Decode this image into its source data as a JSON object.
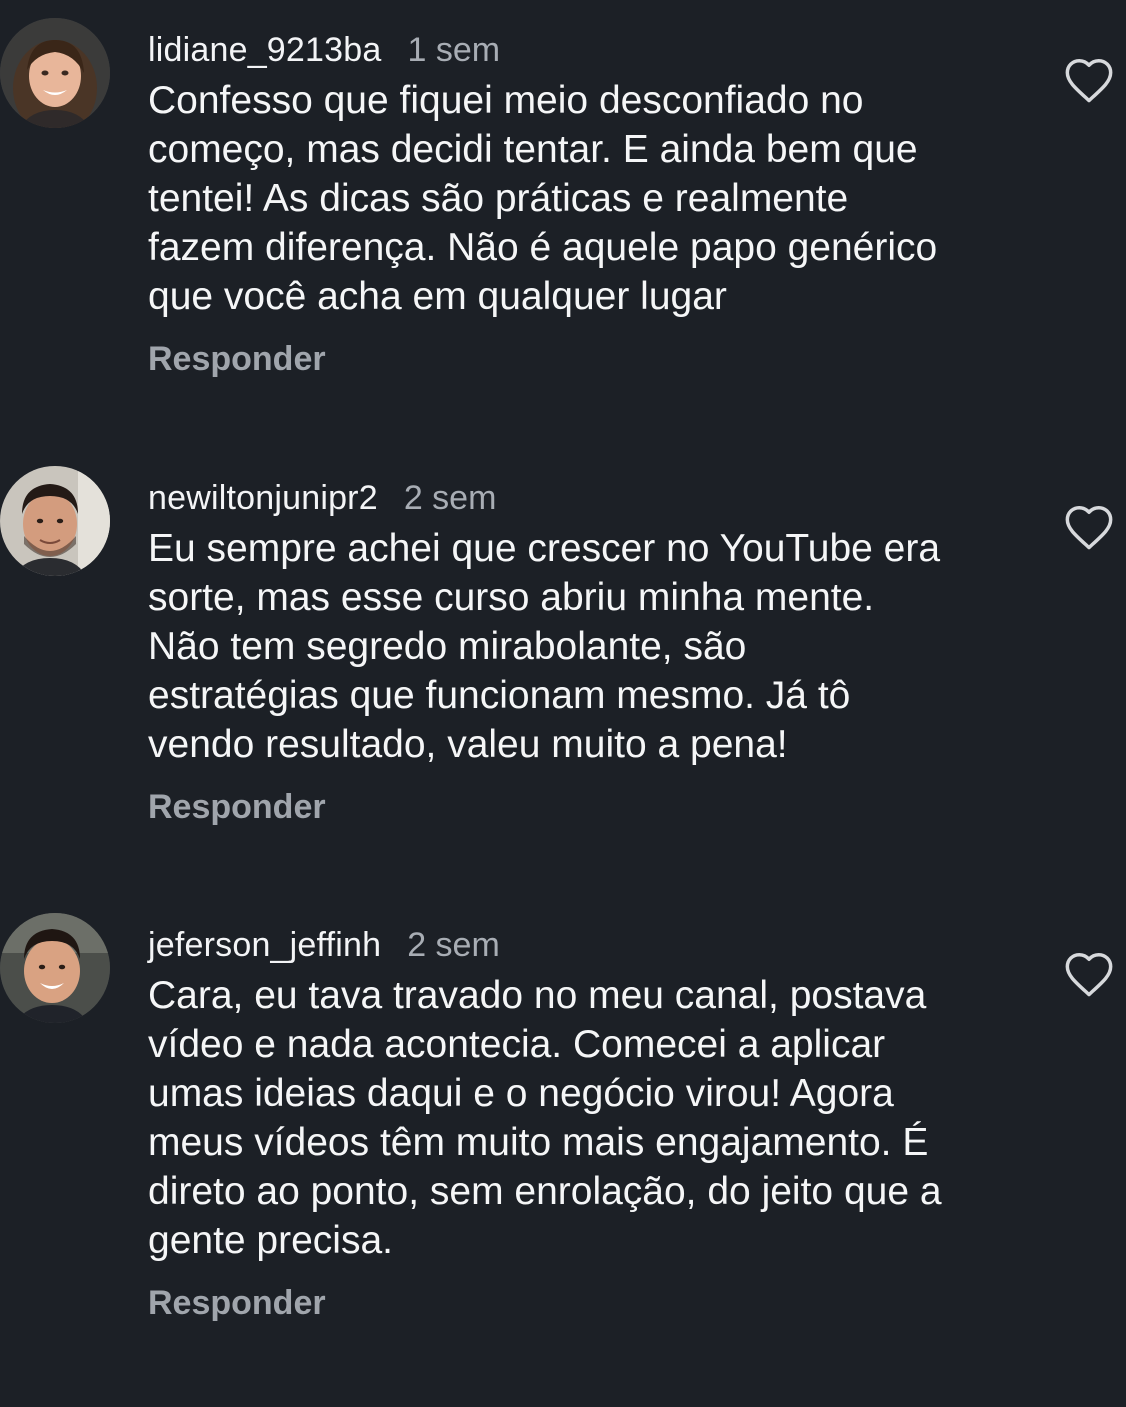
{
  "comments": [
    {
      "username": "lidiane_9213ba",
      "time": "1 sem",
      "text": "Confesso que fiquei meio desconfiado no\ncomeço, mas decidi tentar. E ainda bem que\ntentei! As dicas são práticas e realmente\nfazem diferença. Não é aquele papo genérico\nque você acha em qualquer lugar",
      "reply_label": "Responder",
      "like_icon": "heart-outline-icon"
    },
    {
      "username": "newiltonjunipr2",
      "time": "2 sem",
      "text": "Eu sempre achei que crescer no YouTube era\nsorte, mas esse curso abriu minha mente.\nNão tem segredo mirabolante, são\nestratégias que funcionam mesmo. Já tô\nvendo resultado, valeu muito a pena!",
      "reply_label": "Responder",
      "like_icon": "heart-outline-icon"
    },
    {
      "username": "jeferson_jeffinh",
      "time": "2 sem",
      "text": "Cara, eu tava travado no meu canal, postava\nvídeo e nada acontecia. Comecei a aplicar\numas ideias daqui e o negócio virou! Agora\nmeus vídeos têm muito mais engajamento. É\ndireto ao ponto, sem enrolação, do jeito que a\ngente precisa.",
      "reply_label": "Responder",
      "like_icon": "heart-outline-icon"
    }
  ],
  "colors": {
    "background": "#1c2026",
    "text_primary": "#f3f4f6",
    "text_secondary": "#a8adb4"
  }
}
